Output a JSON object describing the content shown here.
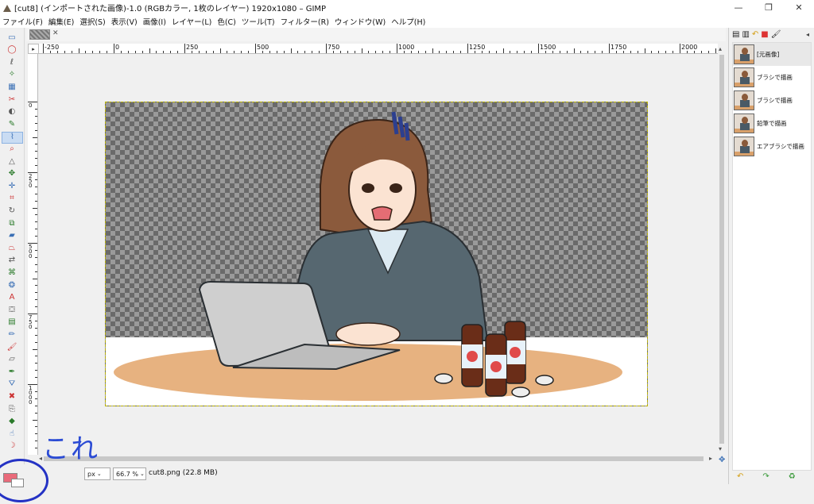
{
  "window": {
    "title": "[cut8] (インポートされた画像)-1.0 (RGBカラー, 1枚のレイヤー) 1920x1080 – GIMP",
    "controls": [
      "—",
      "❐",
      "✕"
    ]
  },
  "menu": [
    "ファイル(F)",
    "編集(E)",
    "選択(S)",
    "表示(V)",
    "画像(I)",
    "レイヤー(L)",
    "色(C)",
    "ツール(T)",
    "フィルター(R)",
    "ウィンドウ(W)",
    "ヘルプ(H)"
  ],
  "toolbox": {
    "tools": [
      {
        "name": "rect-select-icon",
        "glyph": "▭"
      },
      {
        "name": "ellipse-select-icon",
        "glyph": "◯"
      },
      {
        "name": "free-select-icon",
        "glyph": "ℓ"
      },
      {
        "name": "fuzzy-select-icon",
        "glyph": "✧"
      },
      {
        "name": "color-select-icon",
        "glyph": "▦"
      },
      {
        "name": "scissors-icon",
        "glyph": "✂"
      },
      {
        "name": "foreground-select-icon",
        "glyph": "◐"
      },
      {
        "name": "paths-icon",
        "glyph": "✎"
      },
      {
        "name": "color-picker-icon",
        "glyph": "⌇"
      },
      {
        "name": "zoom-icon",
        "glyph": "⌕"
      },
      {
        "name": "measure-icon",
        "glyph": "△"
      },
      {
        "name": "move-icon",
        "glyph": "✥"
      },
      {
        "name": "align-icon",
        "glyph": "✛"
      },
      {
        "name": "crop-icon",
        "glyph": "⌗"
      },
      {
        "name": "rotate-icon",
        "glyph": "↻"
      },
      {
        "name": "scale-icon",
        "glyph": "⧉"
      },
      {
        "name": "shear-icon",
        "glyph": "▰"
      },
      {
        "name": "perspective-icon",
        "glyph": "⏢"
      },
      {
        "name": "flip-icon",
        "glyph": "⇄"
      },
      {
        "name": "cage-icon",
        "glyph": "⌘"
      },
      {
        "name": "warp-icon",
        "glyph": "❂"
      },
      {
        "name": "text-icon",
        "glyph": "A"
      },
      {
        "name": "bucket-fill-icon",
        "glyph": "⛋"
      },
      {
        "name": "blend-icon",
        "glyph": "▤"
      },
      {
        "name": "pencil-icon",
        "glyph": "✏"
      },
      {
        "name": "paintbrush-icon",
        "glyph": "🖌"
      },
      {
        "name": "eraser-icon",
        "glyph": "▱"
      },
      {
        "name": "airbrush-icon",
        "glyph": "✒"
      },
      {
        "name": "ink-icon",
        "glyph": "⛛"
      },
      {
        "name": "heal-icon",
        "glyph": "✖"
      },
      {
        "name": "clone-icon",
        "glyph": "⎘"
      },
      {
        "name": "blur-icon",
        "glyph": "◆"
      },
      {
        "name": "smudge-icon",
        "glyph": "☝"
      },
      {
        "name": "dodge-icon",
        "glyph": "☽"
      }
    ],
    "active_index": 8,
    "fg_color": "#e96a7a",
    "bg_color": "#ffffff"
  },
  "ruler": {
    "h_labels": [
      "-250",
      "0",
      "250",
      "500",
      "750",
      "1000",
      "1250",
      "1500",
      "1750",
      "2000"
    ],
    "v_labels": [
      "0",
      "250",
      "500",
      "750",
      "1000"
    ]
  },
  "status": {
    "unit": "px",
    "zoom": "66.7 %",
    "file": "cut8.png (22.8 MB)"
  },
  "history": {
    "items": [
      "[元画像]",
      "ブラシで描画",
      "ブラシで描画",
      "鉛筆で描画",
      "エアブラシで描画"
    ],
    "selected_index": 0
  },
  "annotation": {
    "text": "これ",
    "color": "#2b4bd4"
  }
}
